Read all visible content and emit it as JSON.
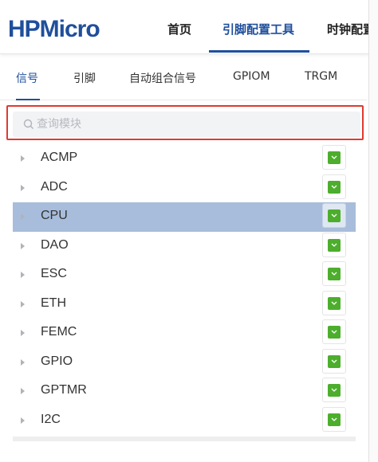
{
  "logo": {
    "text": "HPMicro",
    "color": "#1f4f9c"
  },
  "top_nav": {
    "items": [
      {
        "label": "首页",
        "active": false
      },
      {
        "label": "引脚配置工具",
        "active": true
      },
      {
        "label": "时钟配置工",
        "active": false
      }
    ]
  },
  "sub_tabs": [
    {
      "label": "信号",
      "active": true
    },
    {
      "label": "引脚",
      "active": false
    },
    {
      "label": "自动组合信号",
      "active": false
    },
    {
      "label": "GPIOM",
      "active": false
    },
    {
      "label": "TRGM",
      "active": false
    }
  ],
  "search": {
    "placeholder": "查询模块",
    "value": "",
    "highlight_color": "#e03a2f"
  },
  "modules": [
    {
      "name": "ACMP",
      "checked": true,
      "selected": false
    },
    {
      "name": "ADC",
      "checked": true,
      "selected": false
    },
    {
      "name": "CPU",
      "checked": true,
      "selected": true
    },
    {
      "name": "DAO",
      "checked": true,
      "selected": false
    },
    {
      "name": "ESC",
      "checked": true,
      "selected": false
    },
    {
      "name": "ETH",
      "checked": true,
      "selected": false
    },
    {
      "name": "FEMC",
      "checked": true,
      "selected": false
    },
    {
      "name": "GPIO",
      "checked": true,
      "selected": false
    },
    {
      "name": "GPTMR",
      "checked": true,
      "selected": false
    },
    {
      "name": "I2C",
      "checked": true,
      "selected": false
    }
  ],
  "colors": {
    "accent": "#1f4f9c",
    "checkbox": "#4cae2c",
    "selected_row": "#a8bddb"
  }
}
